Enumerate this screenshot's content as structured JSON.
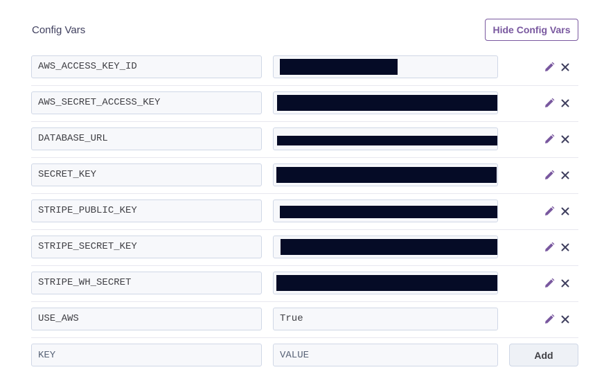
{
  "section": {
    "title": "Config Vars",
    "hide_button_label": "Hide Config Vars"
  },
  "colors": {
    "accent": "#79589f",
    "redaction": "#050b26",
    "delete_icon": "#3f3f5e"
  },
  "icons": {
    "edit": "pencil-icon",
    "delete": "close-icon"
  },
  "vars": [
    {
      "key": "AWS_ACCESS_KEY_ID",
      "value": "",
      "redacted": true
    },
    {
      "key": "AWS_SECRET_ACCESS_KEY",
      "value": "",
      "redacted": true
    },
    {
      "key": "DATABASE_URL",
      "value": "",
      "redacted": true
    },
    {
      "key": "SECRET_KEY",
      "value": "",
      "redacted": true
    },
    {
      "key": "STRIPE_PUBLIC_KEY",
      "value": "",
      "redacted": true
    },
    {
      "key": "STRIPE_SECRET_KEY",
      "value": "",
      "redacted": true
    },
    {
      "key": "STRIPE_WH_SECRET",
      "value": "",
      "redacted": true
    },
    {
      "key": "USE_AWS",
      "value": "True",
      "redacted": false
    }
  ],
  "new_var": {
    "key_placeholder": "KEY",
    "value_placeholder": "VALUE",
    "add_label": "Add"
  }
}
